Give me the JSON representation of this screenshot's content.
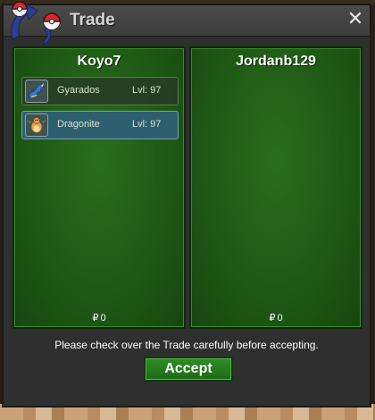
{
  "window": {
    "title": "Trade",
    "close_label": "✕"
  },
  "left_panel": {
    "player": "Koyo7",
    "pokemon": [
      {
        "name": "Gyarados",
        "level": "Lvl: 97",
        "icon": "gyarados-icon",
        "selected": false
      },
      {
        "name": "Dragonite",
        "level": "Lvl: 97",
        "icon": "dragonite-icon",
        "selected": true
      }
    ],
    "money_symbol": "₽",
    "money": "0"
  },
  "right_panel": {
    "player": "Jordanb129",
    "pokemon": [],
    "money_symbol": "₽",
    "money": "0"
  },
  "footer": {
    "notice": "Please check over the Trade carefully before accepting.",
    "accept_label": "Accept"
  },
  "colors": {
    "panel_green": "#1f5a15",
    "accept_green": "#2f8c27",
    "selected_row": "#2e5f6e"
  }
}
